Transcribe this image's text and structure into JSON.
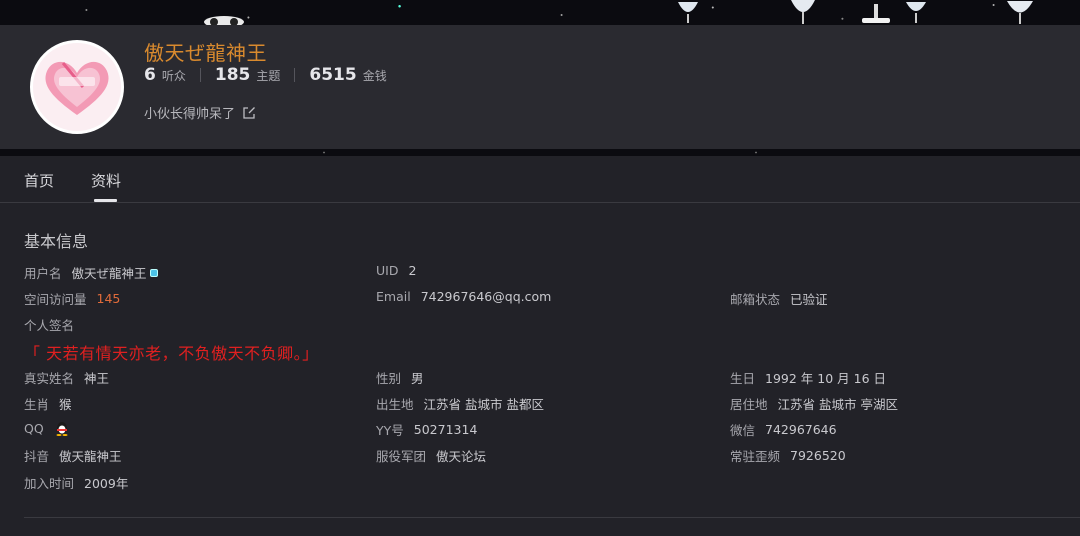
{
  "profile": {
    "username": "傲天ぜ龍神王",
    "signature": "小伙长得帅呆了",
    "stats": [
      {
        "value": "6",
        "label": "听众"
      },
      {
        "value": "185",
        "label": "主题"
      },
      {
        "value": "6515",
        "label": "金钱"
      }
    ]
  },
  "tabs": [
    {
      "label": "首页",
      "active": false
    },
    {
      "label": "资料",
      "active": true
    }
  ],
  "section": {
    "title": "基本信息"
  },
  "fields": {
    "username": {
      "label": "用户名",
      "value": "傲天ぜ龍神王"
    },
    "uid": {
      "label": "UID",
      "value": "2"
    },
    "visits": {
      "label": "空间访问量",
      "value": "145"
    },
    "email": {
      "label": "Email",
      "value": "742967646@qq.com"
    },
    "email_status": {
      "label": "邮箱状态",
      "value": "已验证"
    },
    "sign": {
      "label": "个人签名",
      "value": "「 天若有情天亦老，不负傲天不负卿。」"
    },
    "realname": {
      "label": "真实姓名",
      "value": "神王"
    },
    "gender": {
      "label": "性别",
      "value": "男"
    },
    "birthday": {
      "label": "生日",
      "value": "1992 年 10 月 16 日"
    },
    "zodiac": {
      "label": "生肖",
      "value": "猴"
    },
    "birthplace": {
      "label": "出生地",
      "value": "江苏省 盐城市 盐都区"
    },
    "residence": {
      "label": "居住地",
      "value": "江苏省 盐城市 亭湖区"
    },
    "qq": {
      "label": "QQ"
    },
    "yy": {
      "label": "YY号",
      "value": "50271314"
    },
    "wechat": {
      "label": "微信",
      "value": "742967646"
    },
    "douyin": {
      "label": "抖音",
      "value": "傲天龍神王"
    },
    "legion": {
      "label": "服役军团",
      "value": "傲天论坛"
    },
    "frequency": {
      "label": "常驻歪频",
      "value": "7926520"
    },
    "join": {
      "label": "加入时间",
      "value": "2009年"
    }
  },
  "colors": {
    "username": "#d98a2e",
    "quote": "#e02020",
    "visits": "#e06b3a",
    "background": "#222228"
  }
}
